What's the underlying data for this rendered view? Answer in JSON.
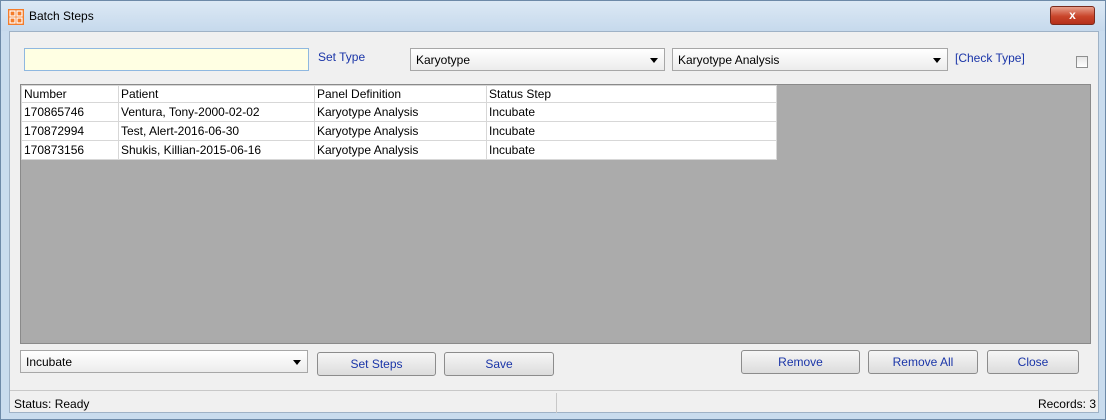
{
  "window": {
    "title": "Batch Steps",
    "close_label": "x"
  },
  "filter": {
    "search_value": "",
    "set_type_label": "Set Type",
    "type_select_value": "Karyotype",
    "panel_select_value": "Karyotype Analysis",
    "check_type_label": "[Check Type]",
    "check_type_checked": false
  },
  "table": {
    "headers": [
      "Number",
      "Patient",
      "Panel Definition",
      "Status Step"
    ],
    "rows": [
      [
        "170865746",
        "Ventura, Tony-2000-02-02",
        "Karyotype Analysis",
        "Incubate"
      ],
      [
        "170872994",
        "Test, Alert-2016-06-30",
        "Karyotype Analysis",
        "Incubate"
      ],
      [
        "170873156",
        "Shukis, Killian-2015-06-16",
        "Karyotype Analysis",
        "Incubate"
      ]
    ]
  },
  "actions": {
    "step_select_value": "Incubate",
    "set_steps_label": "Set Steps",
    "save_label": "Save",
    "remove_label": "Remove",
    "remove_all_label": "Remove All",
    "close_label": "Close"
  },
  "status": {
    "left_text": "Status: Ready",
    "right_text": "Records: 3"
  },
  "colors": {
    "link_blue": "#1a35a8",
    "grid_background": "#ababab",
    "input_background": "#ffffe3"
  }
}
